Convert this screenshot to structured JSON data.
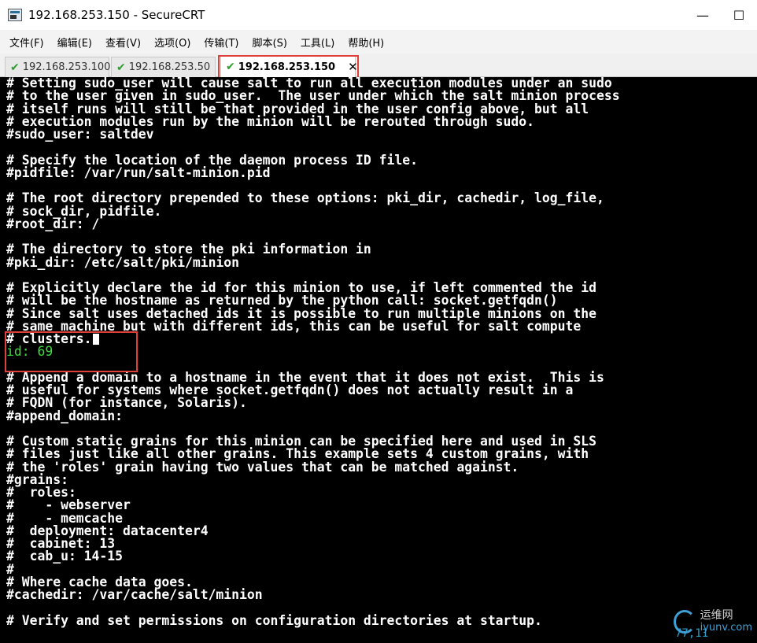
{
  "window": {
    "title": "192.168.253.150 - SecureCRT",
    "minimize_glyph": "—",
    "maximize_glyph": "☐"
  },
  "menu": [
    "文件(F)",
    "编辑(E)",
    "查看(V)",
    "选项(O)",
    "传输(T)",
    "脚本(S)",
    "工具(L)",
    "帮助(H)"
  ],
  "tabs": [
    {
      "label": "192.168.253.100",
      "status_icon": "check-icon",
      "active": false
    },
    {
      "label": "192.168.253.50",
      "status_icon": "check-icon",
      "active": false
    },
    {
      "label": "192.168.253.150",
      "status_icon": "check-icon",
      "active": true
    }
  ],
  "tab_close_glyph": "✕",
  "colors": {
    "terminal_bg": "#000000",
    "terminal_text": "#ffffff",
    "edited_line": "#3cdc3c",
    "highlight_box": "#e0403a",
    "tab_check": "#2e9d2e"
  },
  "terminal": {
    "lines": [
      "# Setting sudo_user will cause salt to run all execution modules under an sudo",
      "# to the user given in sudo_user.  The user under which the salt minion process",
      "# itself runs will still be that provided in the user config above, but all",
      "# execution modules run by the minion will be rerouted through sudo.",
      "#sudo_user: saltdev",
      "",
      "# Specify the location of the daemon process ID file.",
      "#pidfile: /var/run/salt-minion.pid",
      "",
      "# The root directory prepended to these options: pki_dir, cachedir, log_file,",
      "# sock_dir, pidfile.",
      "#root_dir: /",
      "",
      "# The directory to store the pki information in",
      "#pki_dir: /etc/salt/pki/minion",
      "",
      "# Explicitly declare the id for this minion to use, if left commented the id",
      "# will be the hostname as returned by the python call: socket.getfqdn()",
      "# Since salt uses detached ids it is possible to run multiple minions on the",
      "# same machine but with different ids, this can be useful for salt compute",
      "# clusters.",
      "id: 69",
      "",
      "# Append a domain to a hostname in the event that it does not exist.  This is",
      "# useful for systems where socket.getfqdn() does not actually result in a",
      "# FQDN (for instance, Solaris).",
      "#append_domain:",
      "",
      "# Custom static grains for this minion can be specified here and used in SLS",
      "# files just like all other grains. This example sets 4 custom grains, with",
      "# the 'roles' grain having two values that can be matched against.",
      "#grains:",
      "#  roles:",
      "#    - webserver",
      "#    - memcache",
      "#  deployment: datacenter4",
      "#  cabinet: 13",
      "#  cab_u: 14-15",
      "#",
      "# Where cache data goes.",
      "#cachedir: /var/cache/salt/minion",
      "",
      "# Verify and set permissions on configuration directories at startup."
    ],
    "cursor_line_index": 20,
    "edited_line_index": 21,
    "cursor_position": "77,11"
  },
  "watermark": {
    "name": "运维网",
    "url": "iyunv.com"
  }
}
